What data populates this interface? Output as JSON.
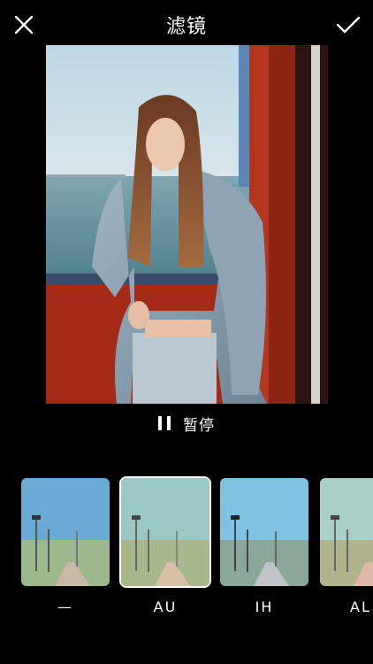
{
  "header": {
    "title": "滤镜"
  },
  "playback": {
    "label": "暂停"
  },
  "filters": [
    {
      "label": "—",
      "selected": false
    },
    {
      "label": "AU",
      "selected": true
    },
    {
      "label": "IH",
      "selected": false
    },
    {
      "label": "AL",
      "selected": false
    }
  ],
  "colors": {
    "background": "#000000",
    "text": "#ffffff",
    "selected_border": "#ffffff"
  }
}
